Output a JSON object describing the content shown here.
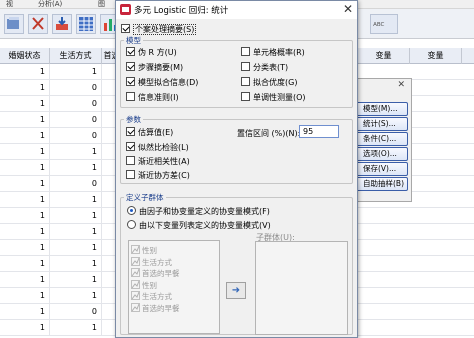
{
  "background": {
    "menu": [
      "视",
      "分析(A)",
      "图"
    ],
    "columns": [
      "婚姻状态",
      "生活方式",
      "首选",
      "变量",
      "变量"
    ],
    "rows": [
      [
        1,
        1,
        ""
      ],
      [
        1,
        0,
        ""
      ],
      [
        1,
        0,
        ""
      ],
      [
        1,
        0,
        ""
      ],
      [
        1,
        0,
        ""
      ],
      [
        1,
        1,
        ""
      ],
      [
        1,
        1,
        ""
      ],
      [
        1,
        0,
        ""
      ],
      [
        1,
        1,
        ""
      ],
      [
        1,
        1,
        ""
      ],
      [
        1,
        1,
        ""
      ],
      [
        1,
        1,
        ""
      ],
      [
        1,
        1,
        ""
      ],
      [
        1,
        1,
        ""
      ],
      [
        1,
        1,
        ""
      ],
      [
        1,
        0,
        ""
      ],
      [
        1,
        1,
        ""
      ]
    ],
    "side_buttons": [
      "模型(M)...",
      "统计(S)...",
      "条件(C)...",
      "选项(O)...",
      "保存(V)...",
      "自助抽样(B)"
    ]
  },
  "dialog": {
    "title": "多元 Logistic 回归: 统计",
    "case_summary": {
      "label": "个案处理摘要(S)",
      "checked": true
    },
    "model": {
      "title": "模型",
      "left": [
        {
          "label": "伪 R 方(U)",
          "checked": true
        },
        {
          "label": "步骤摘要(M)",
          "checked": true
        },
        {
          "label": "模型拟合信息(D)",
          "checked": true
        },
        {
          "label": "信息准则(I)",
          "checked": false
        }
      ],
      "right": [
        {
          "label": "单元格概率(R)",
          "checked": false
        },
        {
          "label": "分类表(T)",
          "checked": false
        },
        {
          "label": "拟合优度(G)",
          "checked": false
        },
        {
          "label": "单调性测量(O)",
          "checked": false
        }
      ]
    },
    "parameters": {
      "title": "参数",
      "items": [
        {
          "label": "估算值(E)",
          "checked": true
        },
        {
          "label": "似然比检验(L)",
          "checked": true
        },
        {
          "label": "渐近相关性(A)",
          "checked": false
        },
        {
          "label": "渐近协方差(C)",
          "checked": false
        }
      ],
      "ci_label": "置信区间 (%)(N):",
      "ci_value": "95"
    },
    "subpop": {
      "title": "定义子群体",
      "radios": [
        {
          "label": "由因子和协变量定义的协变量模式(F)",
          "checked": true
        },
        {
          "label": "由以下变量列表定义的协变量模式(V)",
          "checked": false
        }
      ],
      "list_items": [
        "性别",
        "生活方式",
        "首选的早餐",
        "性别",
        "生活方式",
        "首选的早餐"
      ],
      "subpop_label": "子群体(U):",
      "arrow": "➜"
    }
  }
}
